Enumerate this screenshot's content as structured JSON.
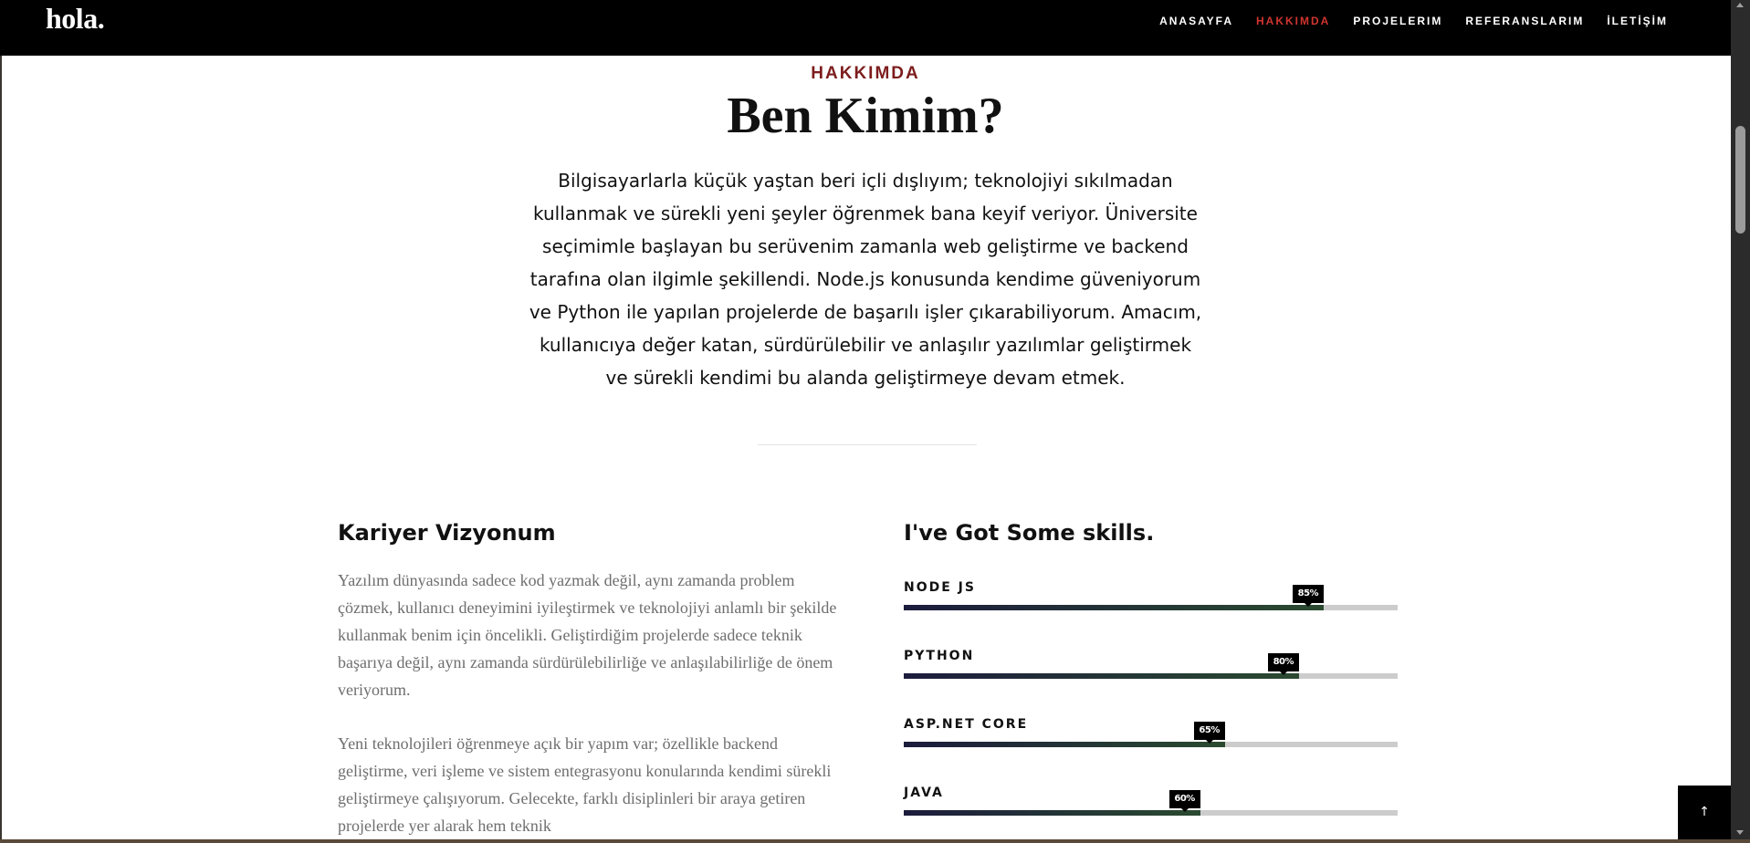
{
  "header": {
    "logo": "hola.",
    "nav": [
      {
        "label": "ANASAYFA",
        "active": false
      },
      {
        "label": "HAKKIMDA",
        "active": true
      },
      {
        "label": "PROJELERIM",
        "active": false
      },
      {
        "label": "REFERANSLARIM",
        "active": false
      },
      {
        "label": "İLETİŞİM",
        "active": false
      }
    ]
  },
  "intro": {
    "eyebrow": "HAKKIMDA",
    "title": "Ben Kimim?",
    "text": "Bilgisayarlarla küçük yaştan beri içli dışlıyım; teknolojiyi sıkılmadan kullanmak ve sürekli yeni şeyler öğrenmek bana keyif veriyor. Üniversite seçimimle başlayan bu serüvenim zamanla web geliştirme ve backend tarafına olan ilgimle şekillendi. Node.js konusunda kendime güveniyorum ve Python ile yapılan projelerde de başarılı işler çıkarabiliyorum. Amacım, kullanıcıya değer katan, sürdürülebilir ve anlaşılır yazılımlar geliştirmek ve sürekli kendimi bu alanda geliştirmeye devam etmek."
  },
  "career": {
    "title": "Kariyer Vizyonum",
    "paragraphs": [
      "Yazılım dünyasında sadece kod yazmak değil, aynı zamanda problem çözmek, kullanıcı deneyimini iyileştirmek ve teknolojiyi anlamlı bir şekilde kullanmak benim için öncelikli. Geliştirdiğim projelerde sadece teknik başarıya değil, aynı zamanda sürdürülebilirliğe ve anlaşılabilirliğe de önem veriyorum.",
      "Yeni teknolojileri öğrenmeye açık bir yapım var; özellikle backend geliştirme, veri işleme ve sistem entegrasyonu konularında kendimi sürekli geliştirmeye çalışıyorum. Gelecekte, farklı disiplinleri bir araya getiren projelerde yer alarak hem teknik"
    ]
  },
  "skills": {
    "title": "I've Got Some skills.",
    "items": [
      {
        "name": "NODE JS",
        "percent": 85,
        "label": "85%"
      },
      {
        "name": "PYTHON",
        "percent": 80,
        "label": "80%"
      },
      {
        "name": "ASP.NET CORE",
        "percent": 65,
        "label": "65%"
      },
      {
        "name": "JAVA",
        "percent": 60,
        "label": "60%"
      }
    ]
  },
  "back_to_top": {
    "icon": "arrow-up-icon",
    "glyph": "↑"
  }
}
